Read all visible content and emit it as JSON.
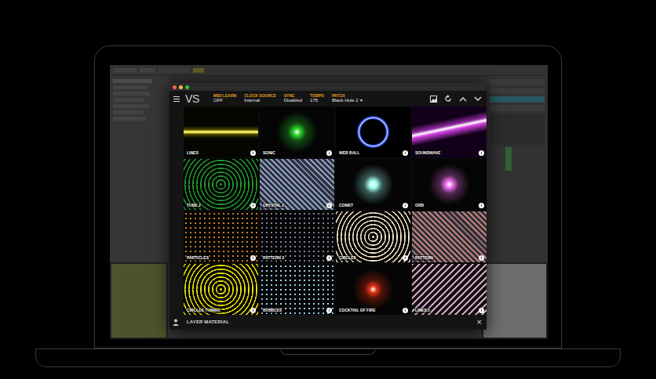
{
  "plugin": {
    "logo": "VS",
    "header": [
      {
        "label": "MIDI LEARN",
        "value": "OFF"
      },
      {
        "label": "CLOCK SOURCE",
        "value": "Internal"
      },
      {
        "label": "SYNC",
        "value": "Disabled"
      },
      {
        "label": "TEMPO",
        "value": "175"
      },
      {
        "label": "PATCH",
        "value": "Black Hole 2"
      }
    ],
    "patch_caret": "▾",
    "info_glyph": "i",
    "tiles": [
      {
        "label": "LINES",
        "kind": "line",
        "color": "#e8e000"
      },
      {
        "label": "SONIC",
        "kind": "glow",
        "color": "#2bd12b"
      },
      {
        "label": "WEB BALL",
        "kind": "ring",
        "color": "#3a5cff"
      },
      {
        "label": "SOUNDWAVE",
        "kind": "wave",
        "color": "#d040e0"
      },
      {
        "label": "TUBE 2",
        "kind": "circles",
        "color": "#1f9a2a"
      },
      {
        "label": "CRYSTAL 2",
        "kind": "texture",
        "color": "#8aa0c0"
      },
      {
        "label": "COMET",
        "kind": "glow",
        "color": "#a0fff0"
      },
      {
        "label": "ORB",
        "kind": "glow",
        "color": "#f070f0"
      },
      {
        "label": "PARTICLES",
        "kind": "dots",
        "color": "#d08020"
      },
      {
        "label": "PATTERN 3",
        "kind": "dots",
        "color": "#8080a0"
      },
      {
        "label": "CIRCLES",
        "kind": "circles",
        "color": "#f0e0c0"
      },
      {
        "label": "PATTERN",
        "kind": "texture",
        "color": "#c08070"
      },
      {
        "label": "CIRCLES TUNNEL",
        "kind": "circles",
        "color": "#e8e000"
      },
      {
        "label": "BUBBLES",
        "kind": "dots",
        "color": "#9ad0f0"
      },
      {
        "label": "COCKTAIL OF FIRE",
        "kind": "glow",
        "color": "#e03010"
      },
      {
        "label": "LINES 2",
        "kind": "stripes",
        "color": "#d0a0c0"
      }
    ],
    "footer": {
      "label": "LAYER MATERIAL",
      "close": "×"
    }
  }
}
